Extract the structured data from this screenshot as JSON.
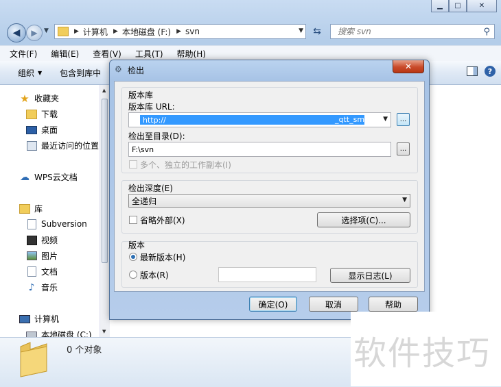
{
  "window": {
    "min": "▁",
    "max": "□",
    "close": "✕"
  },
  "address": {
    "crumbs": [
      "计算机",
      "本地磁盘 (F:)",
      "svn"
    ]
  },
  "search": {
    "placeholder": "搜索 svn"
  },
  "menu": [
    "文件(F)",
    "编辑(E)",
    "查看(V)",
    "工具(T)",
    "帮助(H)"
  ],
  "toolbar": {
    "organize": "组织",
    "include_library": "包含到库中"
  },
  "sidebar": {
    "favorites": "收藏夹",
    "downloads": "下载",
    "desktop": "桌面",
    "recent": "最近访问的位置",
    "wps_cloud": "WPS云文档",
    "libraries": "库",
    "subversion": "Subversion",
    "videos": "视频",
    "pictures": "图片",
    "documents": "文档",
    "music": "音乐",
    "computer": "计算机",
    "local_disk": "本地磁盘 (C:)"
  },
  "status": {
    "count": "0 个对象"
  },
  "dialog": {
    "title": "检出",
    "close": "✕",
    "repo_group": "版本库",
    "repo_url_label": "版本库 URL:",
    "repo_url_value": "http://",
    "repo_url_tail": "_qtt_sms",
    "checkout_dir_label": "检出至目录(D):",
    "checkout_dir_value": "F:\\svn",
    "browse": "...",
    "multi_wc": "多个、独立的工作副本(I)",
    "depth_label": "检出深度(E)",
    "depth_value": "全递归",
    "omit_externals": "省略外部(X)",
    "choose_items": "选择项(C)...",
    "revision_group": "版本",
    "head_revision": "最新版本(H)",
    "revision": "版本(R)",
    "show_log": "显示日志(L)",
    "ok": "确定(O)",
    "cancel": "取消",
    "help": "帮助"
  },
  "watermark": "软件技巧",
  "colors": {
    "selection": "#3399ff",
    "accent": "#2c6fb3"
  }
}
